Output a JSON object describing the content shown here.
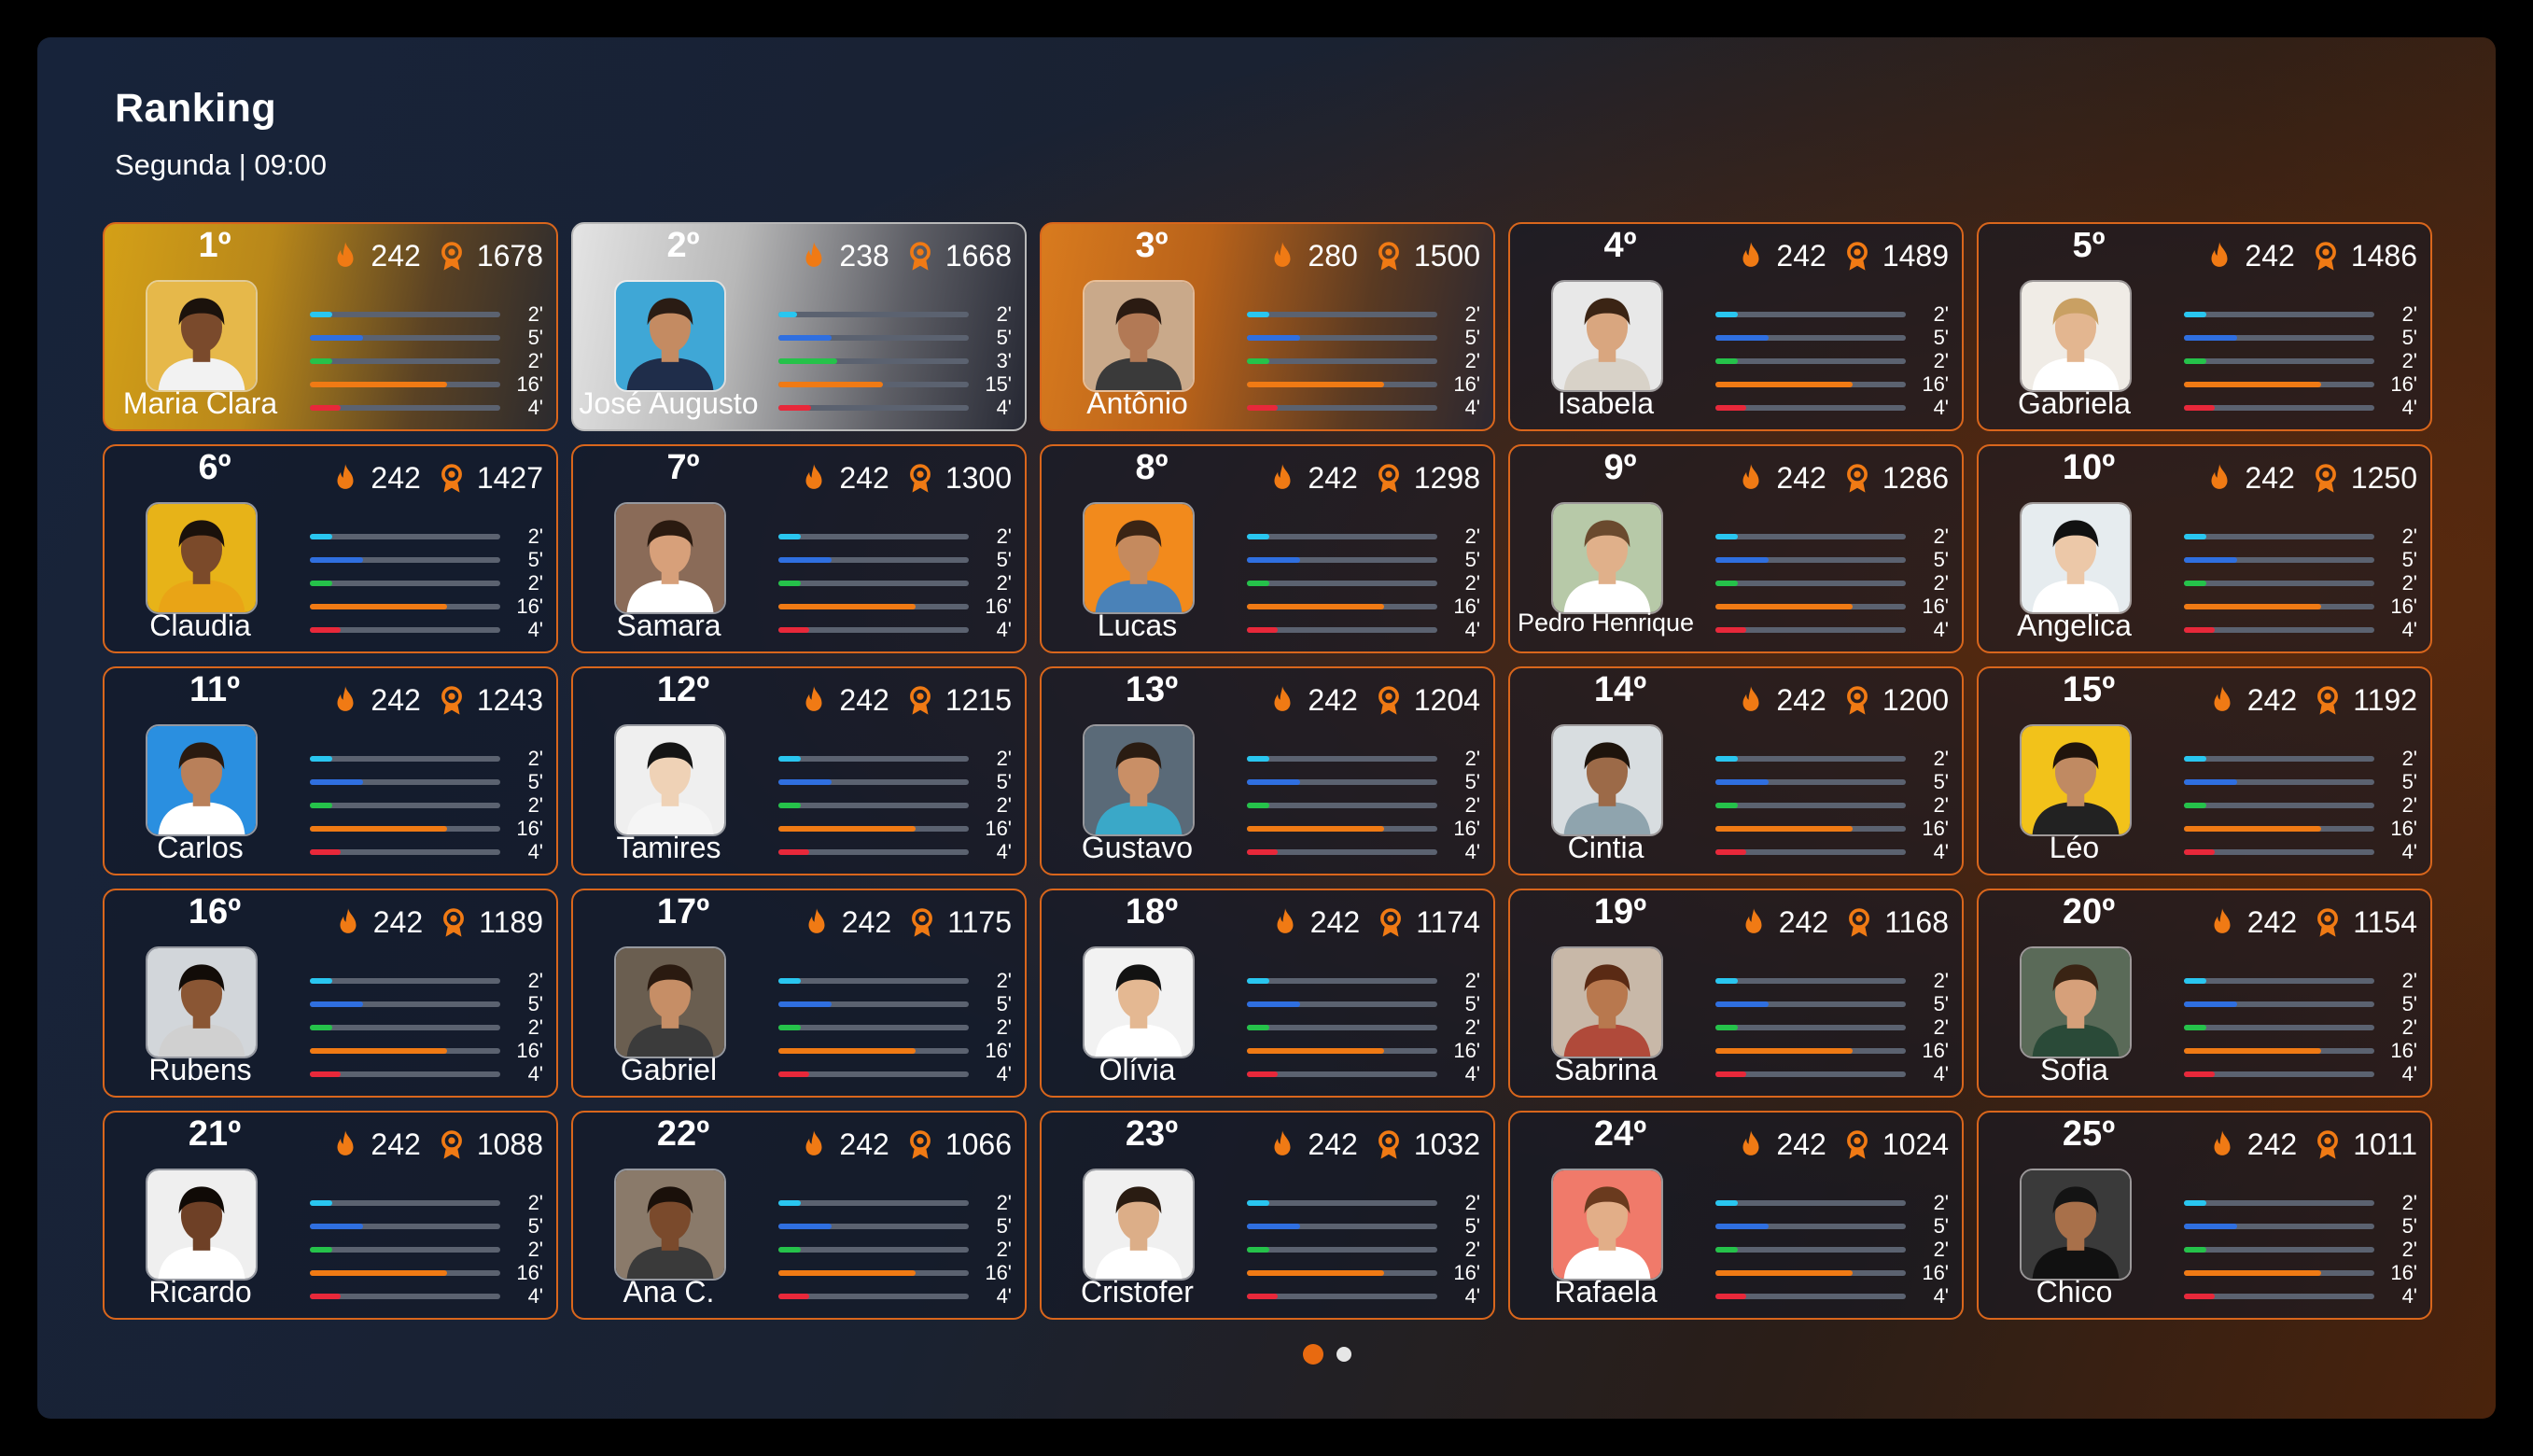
{
  "header": {
    "title": "Ranking",
    "subtitle": "Segunda | 09:00"
  },
  "colors": {
    "accent": "#e86a10",
    "bar_cyan": "#29c6f0",
    "bar_blue": "#2f6fe0",
    "bar_green": "#25c24a",
    "bar_orange": "#f07a14",
    "bar_red": "#e8283a"
  },
  "icons": {
    "flame": "flame-icon",
    "medal": "medal-icon"
  },
  "bars": [
    {
      "color": "#29c6f0",
      "value": 0.12
    },
    {
      "color": "#2f6fe0",
      "value": 0.28
    },
    {
      "color": "#25c24a",
      "value": 0.12
    },
    {
      "color": "#f07a14",
      "value": 0.72
    },
    {
      "color": "#e8283a",
      "value": 0.16
    }
  ],
  "bars_second": [
    0.1,
    0.28,
    0.31,
    0.55,
    0.17
  ],
  "players": [
    {
      "rank": "1º",
      "name": "Maria Clara",
      "flame": "242",
      "points": "1678",
      "labels": [
        "2'",
        "5'",
        "2'",
        "16'",
        "4'"
      ],
      "style": "gold",
      "skin": "#7a4a2c",
      "hair": "#1b120c",
      "bg": "#e6b84a",
      "shirt": "#f2f2f2"
    },
    {
      "rank": "2º",
      "name": "José Augusto",
      "flame": "238",
      "points": "1668",
      "labels": [
        "2'",
        "5'",
        "3'",
        "15'",
        "4'"
      ],
      "style": "silver",
      "skin": "#c48b62",
      "hair": "#2a1c14",
      "bg": "#3fa7d6",
      "shirt": "#1f2d4a"
    },
    {
      "rank": "3º",
      "name": "Antônio",
      "flame": "280",
      "points": "1500",
      "labels": [
        "2'",
        "5'",
        "2'",
        "16'",
        "4'"
      ],
      "style": "bronze",
      "skin": "#b27955",
      "hair": "#2b1b12",
      "bg": "#c9a98a",
      "shirt": "#3a3a3a"
    },
    {
      "rank": "4º",
      "name": "Isabela",
      "flame": "242",
      "points": "1489",
      "labels": [
        "2'",
        "5'",
        "2'",
        "16'",
        "4'"
      ],
      "style": "normal",
      "skin": "#d9a67f",
      "hair": "#3b2414",
      "bg": "#e8e8e8",
      "shirt": "#d8d2c8"
    },
    {
      "rank": "5º",
      "name": "Gabriela",
      "flame": "242",
      "points": "1486",
      "labels": [
        "2'",
        "5'",
        "2'",
        "16'",
        "4'"
      ],
      "style": "normal",
      "skin": "#e3b690",
      "hair": "#c9a063",
      "bg": "#f0ece6",
      "shirt": "#ffffff"
    },
    {
      "rank": "6º",
      "name": "Claudia",
      "flame": "242",
      "points": "1427",
      "labels": [
        "2'",
        "5'",
        "2'",
        "16'",
        "4'"
      ],
      "style": "normal",
      "skin": "#7b4a2a",
      "hair": "#1a110b",
      "bg": "#e7b318",
      "shirt": "#e9a416"
    },
    {
      "rank": "7º",
      "name": "Samara",
      "flame": "242",
      "points": "1300",
      "labels": [
        "2'",
        "5'",
        "2'",
        "16'",
        "4'"
      ],
      "style": "normal",
      "skin": "#d7a07a",
      "hair": "#2a1a10",
      "bg": "#8a6b58",
      "shirt": "#ffffff"
    },
    {
      "rank": "8º",
      "name": "Lucas",
      "flame": "242",
      "points": "1298",
      "labels": [
        "2'",
        "5'",
        "2'",
        "16'",
        "4'"
      ],
      "style": "normal",
      "skin": "#c58a5e",
      "hair": "#3a2414",
      "bg": "#f28a1c",
      "shirt": "#4a82b8"
    },
    {
      "rank": "9º",
      "name": "Pedro Henrique",
      "flame": "242",
      "points": "1286",
      "labels": [
        "2'",
        "5'",
        "2'",
        "16'",
        "4'"
      ],
      "style": "normal",
      "skin": "#e0b08a",
      "hair": "#6a4a2e",
      "bg": "#b7c9a8",
      "shirt": "#ffffff"
    },
    {
      "rank": "10º",
      "name": "Angelica",
      "flame": "242",
      "points": "1250",
      "labels": [
        "2'",
        "5'",
        "2'",
        "16'",
        "4'"
      ],
      "style": "normal",
      "skin": "#ecc8a8",
      "hair": "#111111",
      "bg": "#e6ecef",
      "shirt": "#ffffff"
    },
    {
      "rank": "11º",
      "name": "Carlos",
      "flame": "242",
      "points": "1243",
      "labels": [
        "2'",
        "5'",
        "2'",
        "16'",
        "4'"
      ],
      "style": "normal",
      "skin": "#b9805a",
      "hair": "#2a1a10",
      "bg": "#2a8fe0",
      "shirt": "#ffffff"
    },
    {
      "rank": "12º",
      "name": "Tamires",
      "flame": "242",
      "points": "1215",
      "labels": [
        "2'",
        "5'",
        "2'",
        "16'",
        "4'"
      ],
      "style": "normal",
      "skin": "#efd2b6",
      "hair": "#151515",
      "bg": "#efefef",
      "shirt": "#f5f5f5"
    },
    {
      "rank": "13º",
      "name": "Gustavo",
      "flame": "242",
      "points": "1204",
      "labels": [
        "2'",
        "5'",
        "2'",
        "16'",
        "4'"
      ],
      "style": "normal",
      "skin": "#c98f66",
      "hair": "#2a1c12",
      "bg": "#5a6a78",
      "shirt": "#3aa8c8"
    },
    {
      "rank": "14º",
      "name": "Cintia",
      "flame": "242",
      "points": "1200",
      "labels": [
        "2'",
        "5'",
        "2'",
        "16'",
        "4'"
      ],
      "style": "normal",
      "skin": "#9c6a48",
      "hair": "#1e140c",
      "bg": "#d8dde0",
      "shirt": "#8fa4ae"
    },
    {
      "rank": "15º",
      "name": "Léo",
      "flame": "242",
      "points": "1192",
      "labels": [
        "2'",
        "5'",
        "2'",
        "16'",
        "4'"
      ],
      "style": "normal",
      "skin": "#c08a62",
      "hair": "#20140c",
      "bg": "#f2c21a",
      "shirt": "#222222"
    },
    {
      "rank": "16º",
      "name": "Rubens",
      "flame": "242",
      "points": "1189",
      "labels": [
        "2'",
        "5'",
        "2'",
        "16'",
        "4'"
      ],
      "style": "normal",
      "skin": "#8a5634",
      "hair": "#120c08",
      "bg": "#d2d6da",
      "shirt": "#d0d0d0"
    },
    {
      "rank": "17º",
      "name": "Gabriel",
      "flame": "242",
      "points": "1175",
      "labels": [
        "2'",
        "5'",
        "2'",
        "16'",
        "4'"
      ],
      "style": "normal",
      "skin": "#c68e66",
      "hair": "#2a1a10",
      "bg": "#6a5e50",
      "shirt": "#3b3b3b"
    },
    {
      "rank": "18º",
      "name": "Olívia",
      "flame": "242",
      "points": "1174",
      "labels": [
        "2'",
        "5'",
        "2'",
        "16'",
        "4'"
      ],
      "style": "normal",
      "skin": "#e4b892",
      "hair": "#121212",
      "bg": "#f2f2f2",
      "shirt": "#ffffff"
    },
    {
      "rank": "19º",
      "name": "Sabrina",
      "flame": "242",
      "points": "1168",
      "labels": [
        "2'",
        "5'",
        "2'",
        "16'",
        "4'"
      ],
      "style": "normal",
      "skin": "#b8784e",
      "hair": "#5a2a14",
      "bg": "#c8b8a8",
      "shirt": "#b04a3a"
    },
    {
      "rank": "20º",
      "name": "Sofia",
      "flame": "242",
      "points": "1154",
      "labels": [
        "2'",
        "5'",
        "2'",
        "16'",
        "4'"
      ],
      "style": "normal",
      "skin": "#d6a07a",
      "hair": "#3a2414",
      "bg": "#5a6a58",
      "shirt": "#2a4a38"
    },
    {
      "rank": "21º",
      "name": "Ricardo",
      "flame": "242",
      "points": "1088",
      "labels": [
        "2'",
        "5'",
        "2'",
        "16'",
        "4'"
      ],
      "style": "normal",
      "skin": "#6e4026",
      "hair": "#100a06",
      "bg": "#efefef",
      "shirt": "#ffffff"
    },
    {
      "rank": "22º",
      "name": "Ana C.",
      "flame": "242",
      "points": "1066",
      "labels": [
        "2'",
        "5'",
        "2'",
        "16'",
        "4'"
      ],
      "style": "normal",
      "skin": "#7a4a2c",
      "hair": "#1a100a",
      "bg": "#8a7a6a",
      "shirt": "#3a3a3a"
    },
    {
      "rank": "23º",
      "name": "Cristofer",
      "flame": "242",
      "points": "1032",
      "labels": [
        "2'",
        "5'",
        "2'",
        "16'",
        "4'"
      ],
      "style": "normal",
      "skin": "#dcae88",
      "hair": "#2a1c12",
      "bg": "#f0f0f0",
      "shirt": "#ffffff"
    },
    {
      "rank": "24º",
      "name": "Rafaela",
      "flame": "242",
      "points": "1024",
      "labels": [
        "2'",
        "5'",
        "2'",
        "16'",
        "4'"
      ],
      "style": "normal",
      "skin": "#e2ae88",
      "hair": "#6a3a1e",
      "bg": "#f07a6a",
      "shirt": "#ffffff"
    },
    {
      "rank": "25º",
      "name": "Chico",
      "flame": "242",
      "points": "1011",
      "labels": [
        "2'",
        "5'",
        "2'",
        "16'",
        "4'"
      ],
      "style": "normal",
      "skin": "#a8704a",
      "hair": "#141414",
      "bg": "#3a3a3a",
      "shirt": "#111111"
    }
  ],
  "pagination": {
    "current": 1,
    "total": 2
  }
}
